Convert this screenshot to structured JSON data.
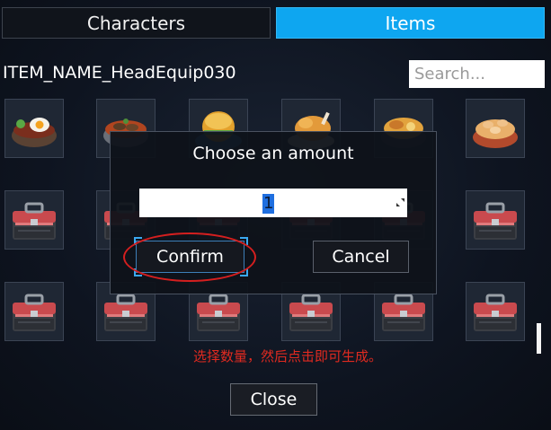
{
  "tabs": {
    "characters_label": "Characters",
    "items_label": "Items"
  },
  "item_name": "ITEM_NAME_HeadEquip030",
  "search": {
    "placeholder": "Search..."
  },
  "grid": {
    "row1": [
      "rice-bowl-icon",
      "stew-bowl-icon",
      "bun-plate-icon",
      "roast-chicken-icon",
      "fried-rice-bowl-icon",
      "shrimp-bowl-icon"
    ],
    "row2": [
      "toolbox-icon",
      "toolbox-icon",
      "toolbox-icon",
      "toolbox-icon",
      "toolbox-icon",
      "toolbox-icon"
    ],
    "row3": [
      "toolbox-icon",
      "toolbox-icon",
      "toolbox-icon",
      "toolbox-icon",
      "toolbox-icon",
      "toolbox-icon"
    ]
  },
  "dialog": {
    "title": "Choose an amount",
    "amount_value": "1",
    "confirm_label": "Confirm",
    "cancel_label": "Cancel"
  },
  "annotation": "选择数量，然后点击即可生成。",
  "close_label": "Close",
  "colors": {
    "accent": "#0ea6f0",
    "annotation_red": "#e02a20",
    "selection_blue": "#1f6fe0"
  }
}
